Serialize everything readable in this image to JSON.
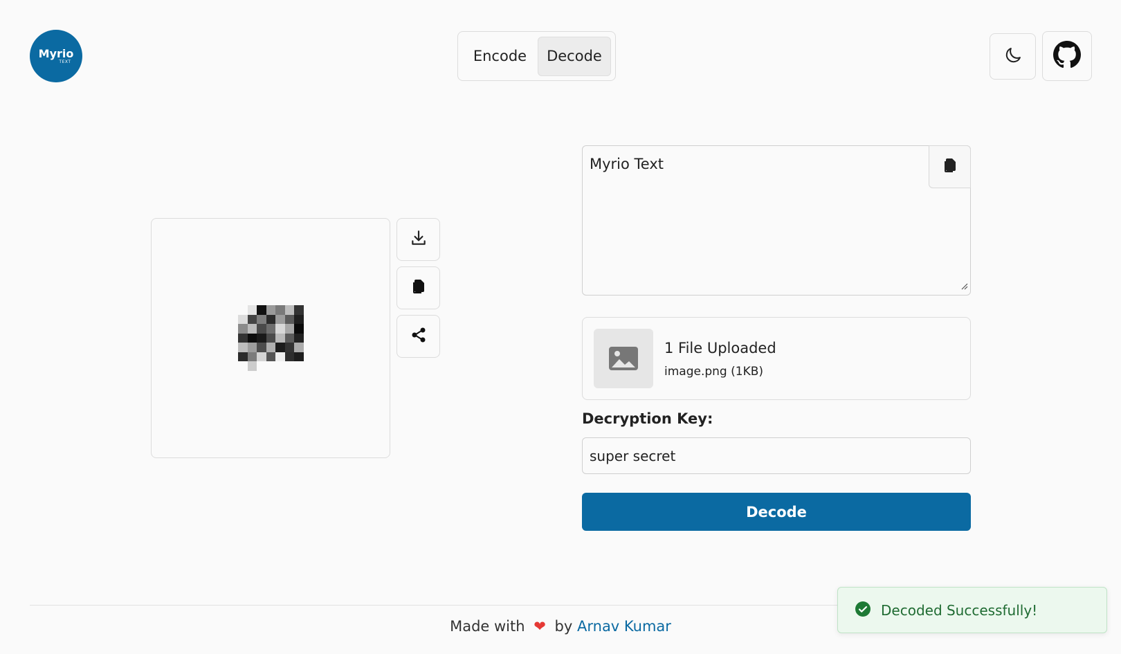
{
  "logo": {
    "name": "Myrio",
    "subtitle": "TEXT"
  },
  "mode_switch": {
    "encode_label": "Encode",
    "decode_label": "Decode",
    "selected": "Decode"
  },
  "header": {
    "theme_icon": "moon-icon",
    "github_icon": "github-icon"
  },
  "preview": {
    "image_alt": "decoded image preview",
    "pixels": [
      "#fafafa",
      "#e4e4e4",
      "#111111",
      "#9a9a9a",
      "#7a7a7a",
      "#bdbdbd",
      "#333333",
      "#dcdcdc",
      "#444444",
      "#7e7e7e",
      "#2b2b2b",
      "#9c9c9c",
      "#5a5a5a",
      "#1f1f1f",
      "#8b8b8b",
      "#bcbcbc",
      "#4a4a4a",
      "#6e6e6e",
      "#d8d8d8",
      "#a8a8a8",
      "#0a0a0a",
      "#333333",
      "#0d0d0d",
      "#1a1a1a",
      "#4b4b4b",
      "#bababa",
      "#5b5b5b",
      "#222222",
      "#bdbdbd",
      "#9d9d9d",
      "#4d4d4d",
      "#b0b0b0",
      "#1c1c1c",
      "#333333",
      "#acacac",
      "#2b2b2b",
      "#7b7b7b",
      "#d4d4d4",
      "#555555",
      "#eeeeee",
      "#2e2e2e",
      "#1d1d1d",
      "#fafafa",
      "#cccccc",
      "#fafafa",
      "#fafafa",
      "#fafafa",
      "#fafafa",
      "#fafafa"
    ],
    "actions": {
      "download_icon": "download-icon",
      "copy_icon": "copy-icon",
      "share_icon": "share-icon"
    }
  },
  "decoded_text": {
    "value": "Myrio Text",
    "copy_icon": "copy-icon"
  },
  "file": {
    "title": "1 File Uploaded",
    "meta": "image.png (1KB)",
    "icon": "image-icon"
  },
  "key": {
    "label": "Decryption Key:",
    "value": "super secret"
  },
  "decode_button": {
    "label": "Decode"
  },
  "footer": {
    "made_with": "Made with",
    "by": "by",
    "author": "Arnav Kumar"
  },
  "toast": {
    "message": "Decoded Successfully!",
    "icon": "check-circle-icon"
  },
  "colors": {
    "brand": "#0b6aa2",
    "success": "#1f6b32",
    "heart": "#e53935"
  }
}
